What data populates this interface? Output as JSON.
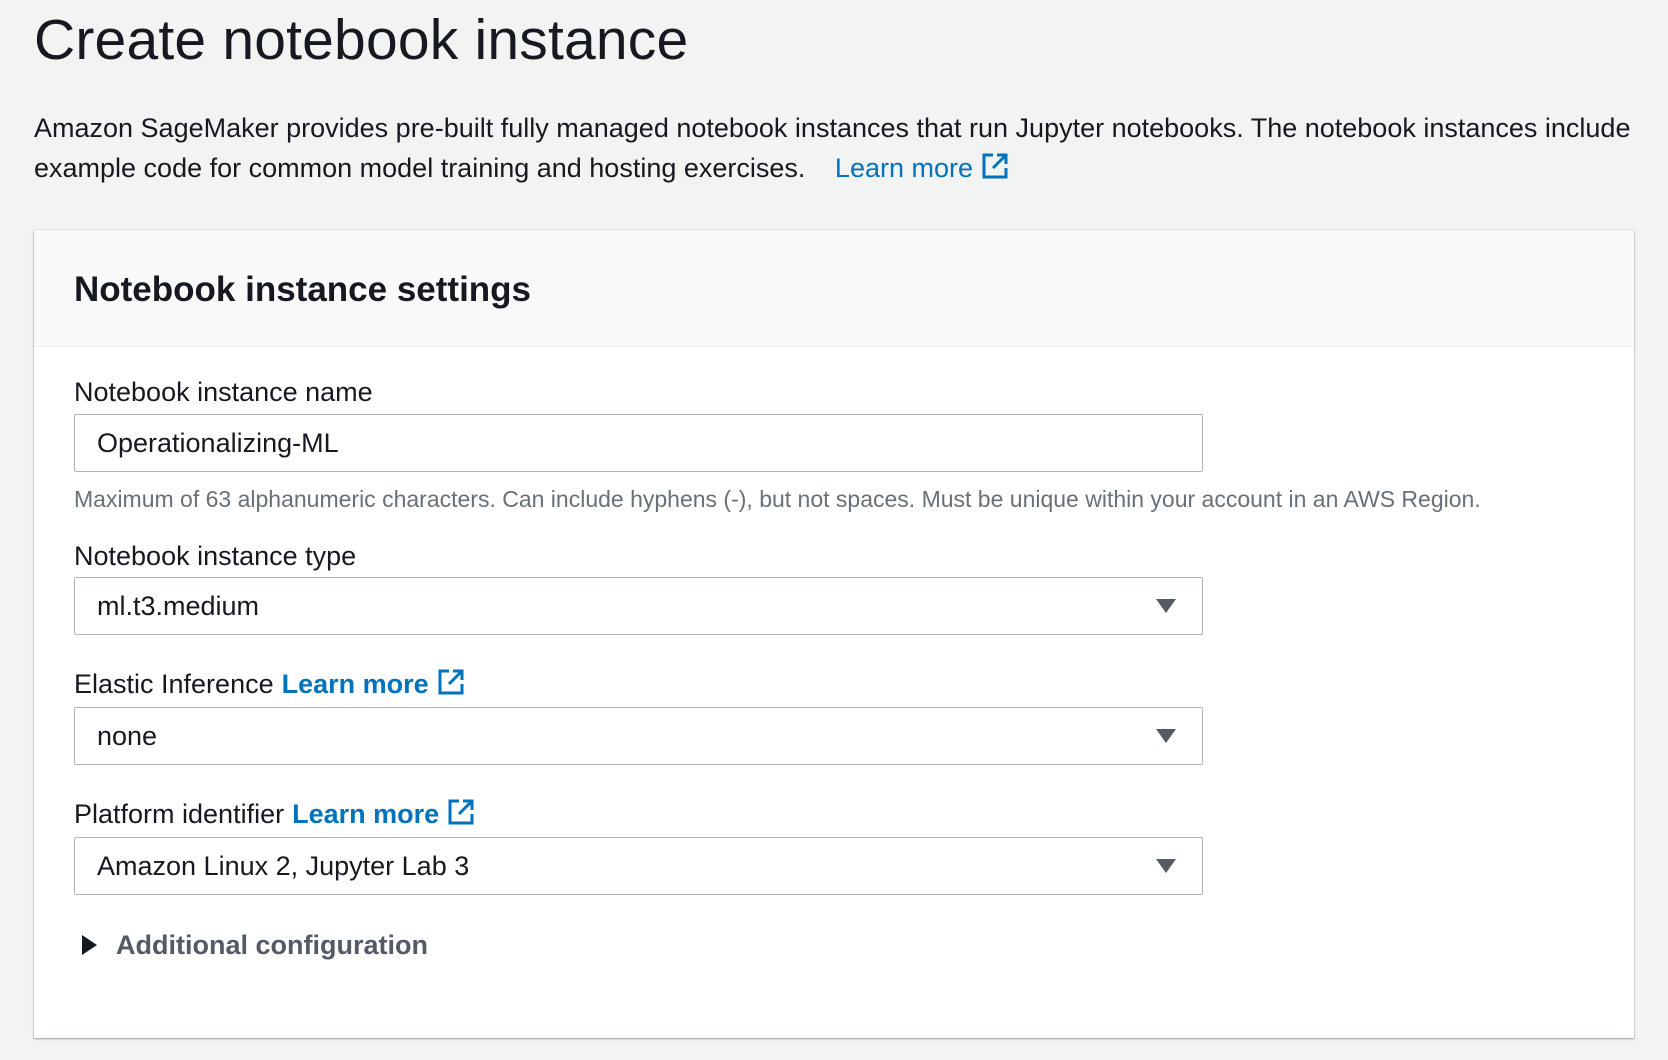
{
  "page": {
    "title": "Create notebook instance",
    "description": "Amazon SageMaker provides pre-built fully managed notebook instances that run Jupyter notebooks. The notebook instances include example code for common model training and hosting exercises.",
    "learn_more": "Learn more"
  },
  "panel": {
    "title": "Notebook instance settings"
  },
  "fields": {
    "name": {
      "label": "Notebook instance name",
      "value": "Operationalizing-ML",
      "hint": "Maximum of 63 alphanumeric characters. Can include hyphens (-), but not spaces. Must be unique within your account in an AWS Region."
    },
    "instance_type": {
      "label": "Notebook instance type",
      "value": "ml.t3.medium"
    },
    "elastic_inference": {
      "label": "Elastic Inference",
      "learn_more": "Learn more",
      "value": "none"
    },
    "platform": {
      "label": "Platform identifier",
      "learn_more": "Learn more",
      "value": "Amazon Linux 2, Jupyter Lab 3"
    }
  },
  "additional": {
    "label": "Additional configuration"
  },
  "icons": {
    "external_link": "external-link-icon",
    "dropdown": "caret-down-icon",
    "expander": "caret-right-icon"
  },
  "colors": {
    "link": "#0073bb",
    "background": "#f2f3f3",
    "panel": "#ffffff",
    "border": "#aab7b8"
  }
}
